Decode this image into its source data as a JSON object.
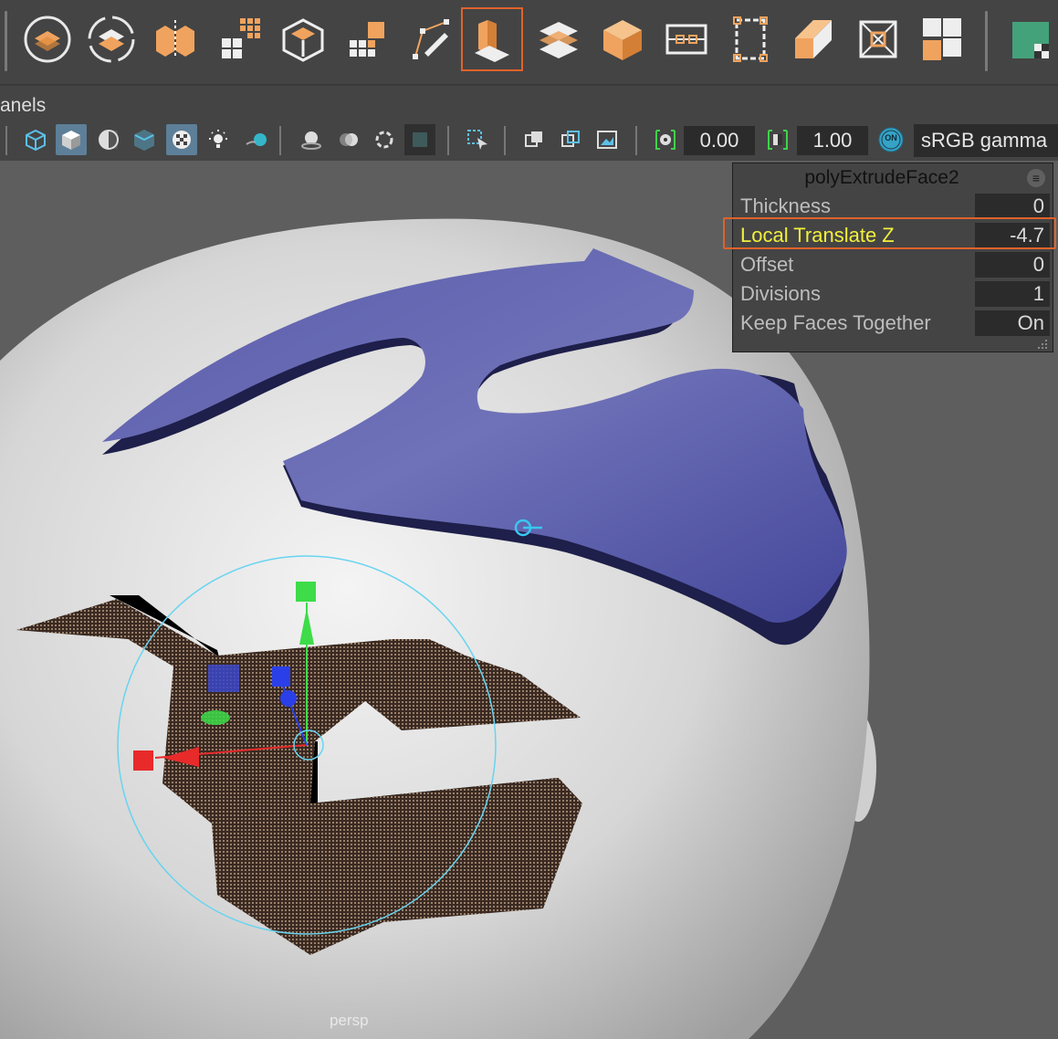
{
  "panel_menu": {
    "label": "anels"
  },
  "viewport_toolbar": {
    "exposure_value": "0.00",
    "gamma_value": "1.00",
    "color_management_toggle": "ON",
    "color_space": "sRGB gamma"
  },
  "hud": {
    "title": "polyExtrudeFace2",
    "rows": [
      {
        "label": "Thickness",
        "value": "0"
      },
      {
        "label": "Local Translate Z",
        "value": "-4.7"
      },
      {
        "label": "Offset",
        "value": "0"
      },
      {
        "label": "Divisions",
        "value": "1"
      },
      {
        "label": "Keep Faces Together",
        "value": "On"
      }
    ]
  },
  "viewport": {
    "camera_label": "persp"
  },
  "colors": {
    "accent_highlight": "#e0622a",
    "selected_attribute_text": "#f2ef3c",
    "extruded_mesh": "#4e4f9c",
    "selected_faces": "#3a2a22",
    "manipulator_ring": "#68d4f0"
  },
  "shelf": {
    "active_tool": "extrude-icon",
    "icons": [
      "combine-icon",
      "separate-icon",
      "mirror-icon",
      "smooth-icon",
      "reduce-icon",
      "cleanup-icon",
      "bridge-icon",
      "multi-cut-icon",
      "extrude-icon",
      "bevel-icon",
      "fill-hole-icon",
      "edge-loop-icon",
      "target-weld-icon",
      "uv-sphere-icon",
      "insert-edge-loop-icon",
      "poke-icon",
      "wedge-icon",
      "triangulate-icon",
      "uv-editor-icon"
    ]
  }
}
